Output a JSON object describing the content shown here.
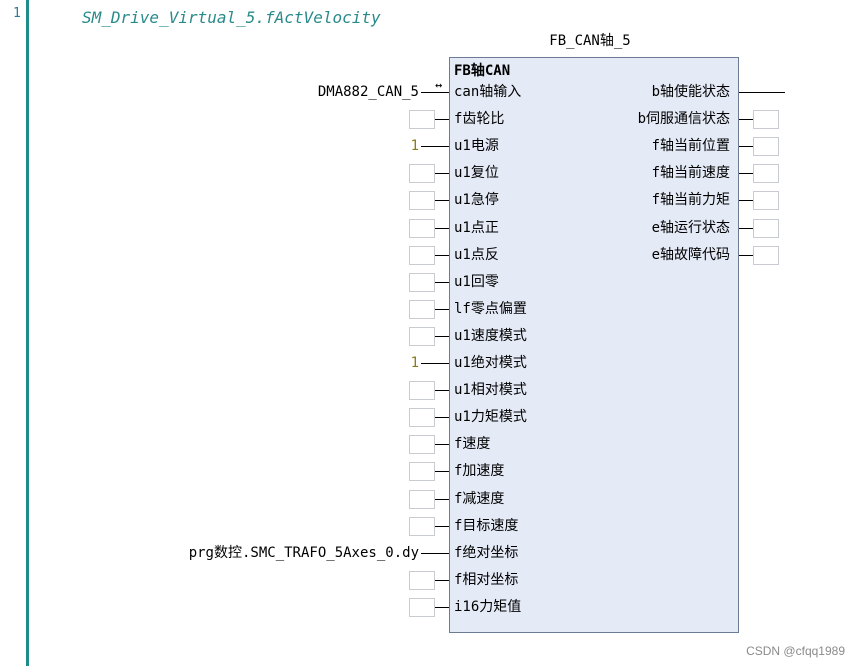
{
  "editor": {
    "line_number": "1",
    "comment": "SM_Drive_Virtual_5.fActVelocity"
  },
  "fb": {
    "instance_name": "FB_CAN轴_5",
    "type_name": "FB轴CAN",
    "inputs": [
      {
        "label": "can轴输入",
        "value": "DMA882_CAN_5",
        "kind": "inout"
      },
      {
        "label": "f齿轮比",
        "value": "",
        "kind": "empty"
      },
      {
        "label": "u1电源",
        "value": "1",
        "kind": "num"
      },
      {
        "label": "u1复位",
        "value": "",
        "kind": "empty"
      },
      {
        "label": "u1急停",
        "value": "",
        "kind": "empty"
      },
      {
        "label": "u1点正",
        "value": "",
        "kind": "empty"
      },
      {
        "label": "u1点反",
        "value": "",
        "kind": "empty"
      },
      {
        "label": "u1回零",
        "value": "",
        "kind": "empty"
      },
      {
        "label": "lf零点偏置",
        "value": "",
        "kind": "empty"
      },
      {
        "label": "u1速度模式",
        "value": "",
        "kind": "empty"
      },
      {
        "label": "u1绝对模式",
        "value": "1",
        "kind": "num"
      },
      {
        "label": "u1相对模式",
        "value": "",
        "kind": "empty"
      },
      {
        "label": "u1力矩模式",
        "value": "",
        "kind": "empty"
      },
      {
        "label": "f速度",
        "value": "",
        "kind": "empty"
      },
      {
        "label": "f加速度",
        "value": "",
        "kind": "empty"
      },
      {
        "label": "f减速度",
        "value": "",
        "kind": "empty"
      },
      {
        "label": "f目标速度",
        "value": "",
        "kind": "empty"
      },
      {
        "label": "f绝对坐标",
        "value": "prg数控.SMC_TRAFO_5Axes_0.dy",
        "kind": "text"
      },
      {
        "label": "f相对坐标",
        "value": "",
        "kind": "empty"
      },
      {
        "label": "i16力矩值",
        "value": "",
        "kind": "empty"
      }
    ],
    "outputs": [
      {
        "label": "b轴使能状态",
        "kind": "wire"
      },
      {
        "label": "b伺服通信状态",
        "kind": "empty"
      },
      {
        "label": "f轴当前位置",
        "kind": "empty"
      },
      {
        "label": "f轴当前速度",
        "kind": "empty"
      },
      {
        "label": "f轴当前力矩",
        "kind": "empty"
      },
      {
        "label": "e轴运行状态",
        "kind": "empty"
      },
      {
        "label": "e轴故障代码",
        "kind": "empty"
      }
    ]
  },
  "watermark": "CSDN @cfqq1989"
}
